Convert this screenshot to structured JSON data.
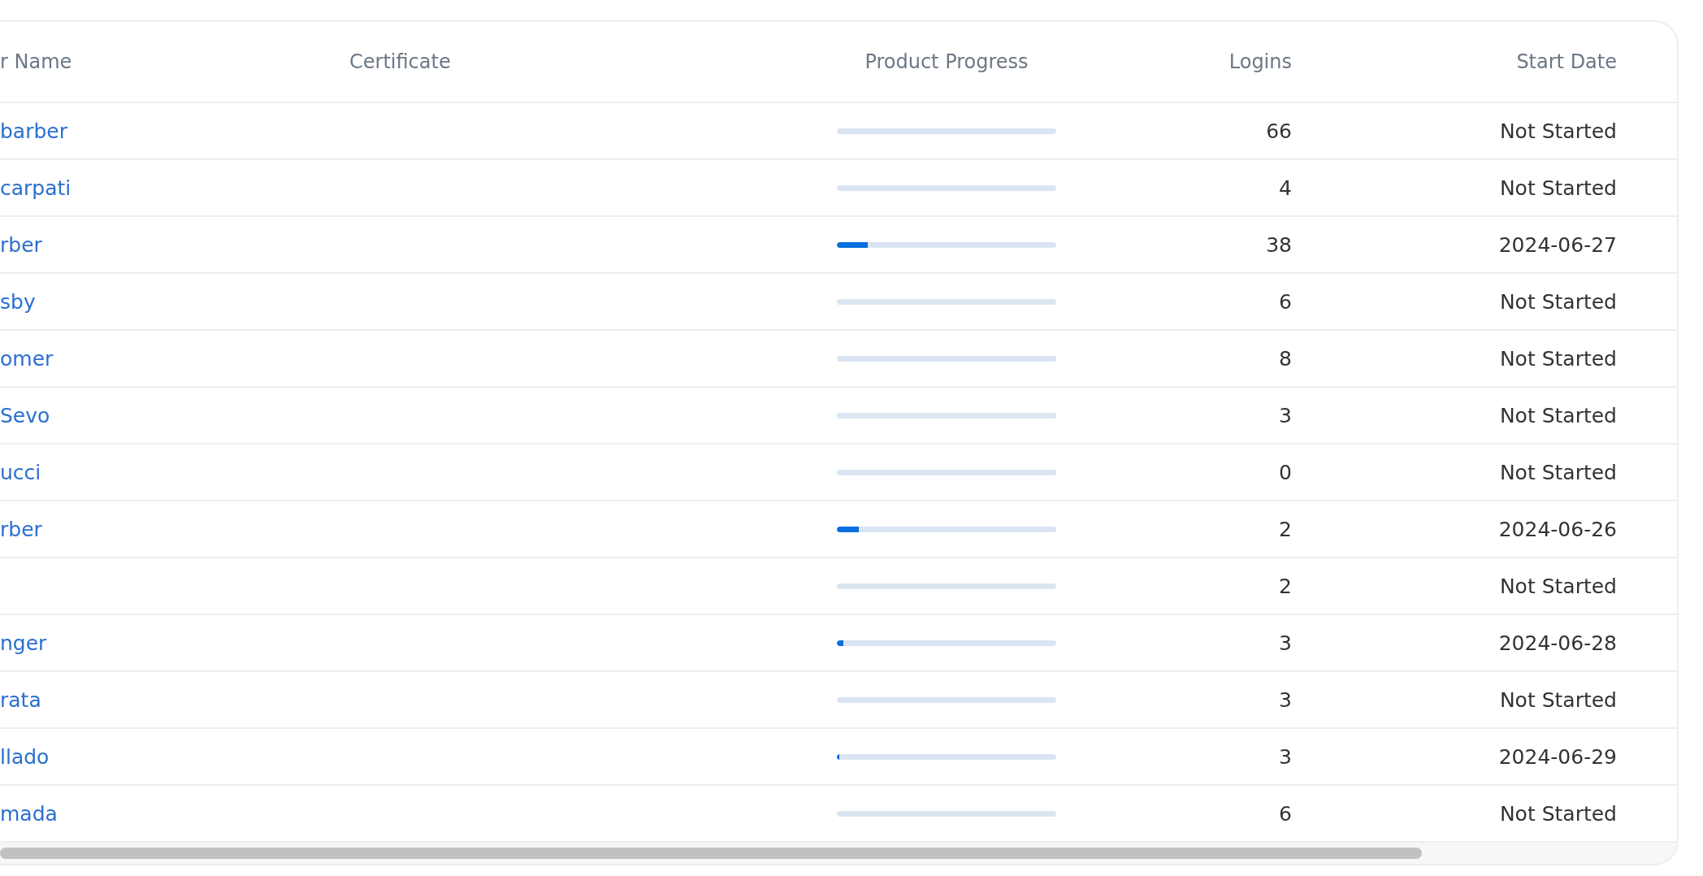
{
  "table": {
    "columns": [
      "r Name",
      "Certificate",
      "Product Progress",
      "Logins",
      "Start Date"
    ],
    "rows": [
      {
        "name": "barber",
        "logins": "66",
        "start_date": "Not Started"
      },
      {
        "name": "carpati",
        "logins": "4",
        "start_date": "Not Started"
      },
      {
        "name": "rber",
        "level": 0.14,
        "logins": "38",
        "start_date": "2024-06-27"
      },
      {
        "name": "sby",
        "logins": "6",
        "start_date": "Not Started"
      },
      {
        "name": "omer",
        "logins": "8",
        "start_date": "Not Started"
      },
      {
        "name": "Sevo",
        "logins": "3",
        "start_date": "Not Started"
      },
      {
        "name": "ucci",
        "logins": "0",
        "start_date": "Not Started"
      },
      {
        "name": "rber",
        "level": 0.1,
        "logins": "2",
        "start_date": "2024-06-26"
      },
      {
        "logins": "2",
        "start_date": "Not Started"
      },
      {
        "name": "nger",
        "level": 0.03,
        "logins": "3",
        "start_date": "2024-06-28"
      },
      {
        "name": "rata",
        "logins": "3",
        "start_date": "Not Started"
      },
      {
        "name": "llado",
        "level": 0.01,
        "logins": "3",
        "start_date": "2024-06-29"
      },
      {
        "name": "mada",
        "logins": "6",
        "start_date": "Not Started"
      }
    ]
  }
}
